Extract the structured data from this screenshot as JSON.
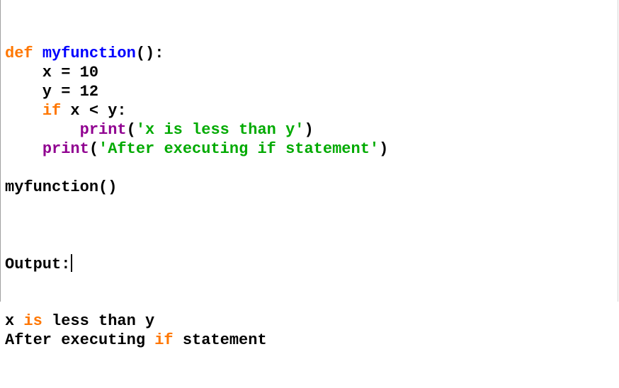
{
  "code": {
    "lines": [
      [
        {
          "t": "def",
          "c": "kw"
        },
        {
          "t": " ",
          "c": "plain"
        },
        {
          "t": "myfunction",
          "c": "fn"
        },
        {
          "t": "():",
          "c": "plain"
        }
      ],
      [
        {
          "t": "    x = 10",
          "c": "plain"
        }
      ],
      [
        {
          "t": "    y = 12",
          "c": "plain"
        }
      ],
      [
        {
          "t": "    ",
          "c": "plain"
        },
        {
          "t": "if",
          "c": "kw"
        },
        {
          "t": " x < y:",
          "c": "plain"
        }
      ],
      [
        {
          "t": "        ",
          "c": "plain"
        },
        {
          "t": "print",
          "c": "bi"
        },
        {
          "t": "(",
          "c": "plain"
        },
        {
          "t": "'x is less than y'",
          "c": "str"
        },
        {
          "t": ")",
          "c": "plain"
        }
      ],
      [
        {
          "t": "    ",
          "c": "plain"
        },
        {
          "t": "print",
          "c": "bi"
        },
        {
          "t": "(",
          "c": "plain"
        },
        {
          "t": "'After executing if statement'",
          "c": "str"
        },
        {
          "t": ")",
          "c": "plain"
        }
      ],
      [],
      [
        {
          "t": "myfunction()",
          "c": "plain"
        }
      ],
      []
    ]
  },
  "output": {
    "label": "Output:",
    "lines": [
      [
        {
          "t": "x ",
          "c": "plain"
        },
        {
          "t": "is",
          "c": "kw"
        },
        {
          "t": " less than y",
          "c": "plain"
        }
      ],
      [
        {
          "t": "After executing ",
          "c": "plain"
        },
        {
          "t": "if",
          "c": "kw"
        },
        {
          "t": " statement",
          "c": "plain"
        }
      ]
    ]
  },
  "colors": {
    "keyword": "#ff7700",
    "function_name": "#0000ff",
    "builtin": "#900090",
    "string": "#00aa00",
    "text": "#000000",
    "background": "#ffffff"
  }
}
